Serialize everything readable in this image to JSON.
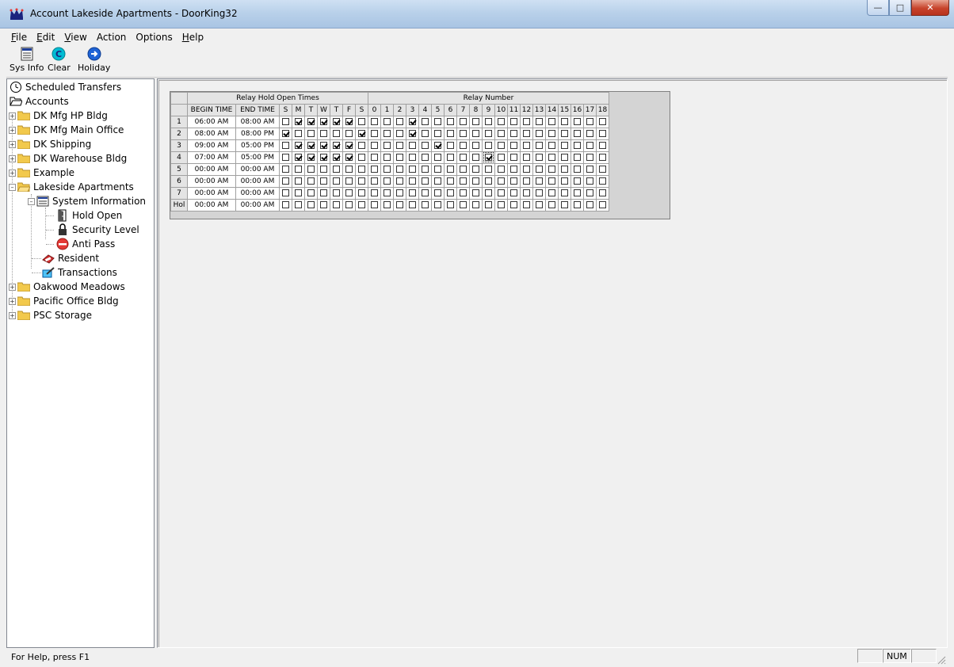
{
  "window": {
    "title": "Account Lakeside Apartments - DoorKing32"
  },
  "menu": [
    {
      "u": "F",
      "rest": "ile"
    },
    {
      "u": "E",
      "rest": "dit"
    },
    {
      "u": "V",
      "rest": "iew"
    },
    {
      "u": "",
      "rest": "Action"
    },
    {
      "u": "",
      "rest": "Options"
    },
    {
      "u": "H",
      "rest": "elp"
    }
  ],
  "toolbar": {
    "sysinfo": "Sys Info",
    "clear": "Clear",
    "holiday": "Holiday"
  },
  "tree": {
    "scheduled": "Scheduled Transfers",
    "accounts": "Accounts",
    "dk_hp": "DK Mfg HP Bldg",
    "dk_main": "DK Mfg Main Office",
    "dk_ship": "DK Shipping",
    "dk_ware": "DK Warehouse Bldg",
    "example": "Example",
    "lakeside": "Lakeside Apartments",
    "sysinfo": "System Information",
    "hold_open": "Hold Open",
    "security": "Security Level",
    "antipass": "Anti Pass",
    "resident": "Resident",
    "transactions": "Transactions",
    "oakwood": "Oakwood Meadows",
    "pacific": "Pacific Office Bldg",
    "psc": "PSC Storage"
  },
  "grid": {
    "group_times": "Relay Hold Open Times",
    "group_relay": "Relay Number",
    "col_begin": "BEGIN TIME",
    "col_end": "END TIME",
    "days": [
      "S",
      "M",
      "T",
      "W",
      "T",
      "F",
      "S"
    ],
    "relays": [
      "0",
      "1",
      "2",
      "3",
      "4",
      "5",
      "6",
      "7",
      "8",
      "9",
      "10",
      "11",
      "12",
      "13",
      "14",
      "15",
      "16",
      "17",
      "18"
    ],
    "rows": [
      {
        "label": "1",
        "begin": "06:00 AM",
        "end": "08:00 AM",
        "days": [
          0,
          1,
          1,
          1,
          1,
          1,
          0
        ],
        "relays": [
          0,
          0,
          0,
          1,
          0,
          0,
          0,
          0,
          0,
          0,
          0,
          0,
          0,
          0,
          0,
          0,
          0,
          0,
          0
        ]
      },
      {
        "label": "2",
        "begin": "08:00 AM",
        "end": "08:00 PM",
        "days": [
          1,
          0,
          0,
          0,
          0,
          0,
          1
        ],
        "relays": [
          0,
          0,
          0,
          1,
          0,
          0,
          0,
          0,
          0,
          0,
          0,
          0,
          0,
          0,
          0,
          0,
          0,
          0,
          0
        ]
      },
      {
        "label": "3",
        "begin": "09:00 AM",
        "end": "05:00 PM",
        "days": [
          0,
          1,
          1,
          1,
          1,
          1,
          0
        ],
        "relays": [
          0,
          0,
          0,
          0,
          0,
          1,
          0,
          0,
          0,
          0,
          0,
          0,
          0,
          0,
          0,
          0,
          0,
          0,
          0
        ]
      },
      {
        "label": "4",
        "begin": "07:00 AM",
        "end": "05:00 PM",
        "days": [
          0,
          1,
          1,
          1,
          1,
          1,
          0
        ],
        "relays": [
          0,
          0,
          0,
          0,
          0,
          0,
          0,
          0,
          0,
          1,
          0,
          0,
          0,
          0,
          0,
          0,
          0,
          0,
          0
        ]
      },
      {
        "label": "5",
        "begin": "00:00 AM",
        "end": "00:00 AM",
        "days": [
          0,
          0,
          0,
          0,
          0,
          0,
          0
        ],
        "relays": [
          0,
          0,
          0,
          0,
          0,
          0,
          0,
          0,
          0,
          0,
          0,
          0,
          0,
          0,
          0,
          0,
          0,
          0,
          0
        ]
      },
      {
        "label": "6",
        "begin": "00:00 AM",
        "end": "00:00 AM",
        "days": [
          0,
          0,
          0,
          0,
          0,
          0,
          0
        ],
        "relays": [
          0,
          0,
          0,
          0,
          0,
          0,
          0,
          0,
          0,
          0,
          0,
          0,
          0,
          0,
          0,
          0,
          0,
          0,
          0
        ]
      },
      {
        "label": "7",
        "begin": "00:00 AM",
        "end": "00:00 AM",
        "days": [
          0,
          0,
          0,
          0,
          0,
          0,
          0
        ],
        "relays": [
          0,
          0,
          0,
          0,
          0,
          0,
          0,
          0,
          0,
          0,
          0,
          0,
          0,
          0,
          0,
          0,
          0,
          0,
          0
        ]
      },
      {
        "label": "Hol",
        "begin": "00:00 AM",
        "end": "00:00 AM",
        "days": [
          0,
          0,
          0,
          0,
          0,
          0,
          0
        ],
        "relays": [
          0,
          0,
          0,
          0,
          0,
          0,
          0,
          0,
          0,
          0,
          0,
          0,
          0,
          0,
          0,
          0,
          0,
          0,
          0
        ]
      }
    ]
  },
  "status": {
    "help": "For Help, press F1",
    "num": "NUM"
  }
}
